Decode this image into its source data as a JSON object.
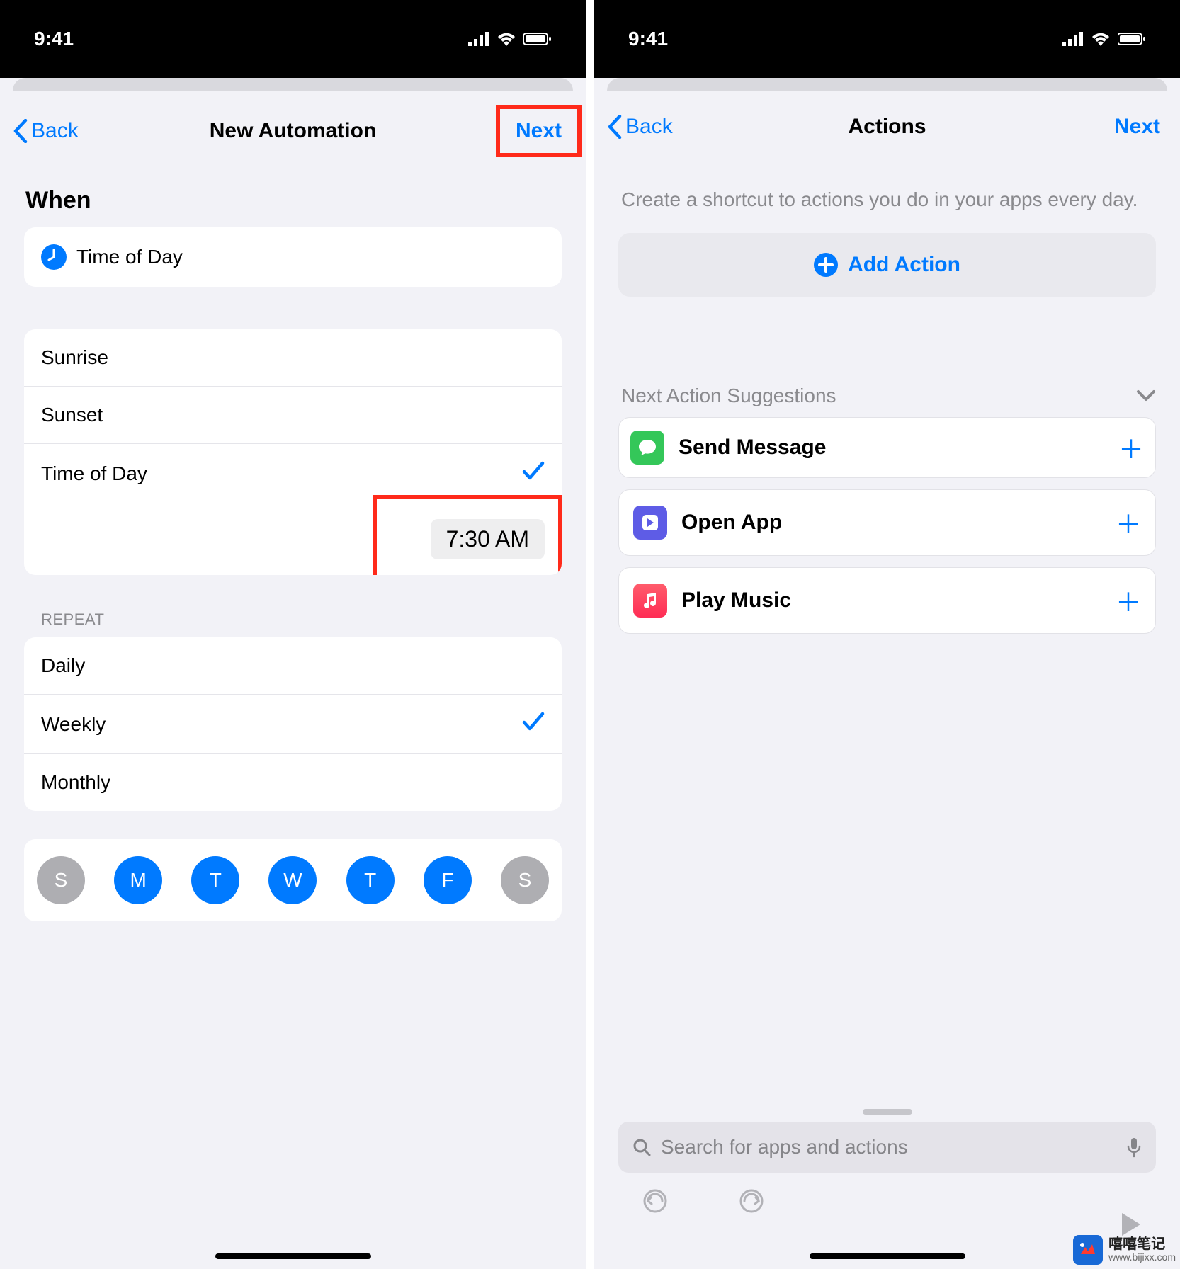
{
  "status": {
    "time": "9:41"
  },
  "left": {
    "nav": {
      "back": "Back",
      "title": "New Automation",
      "next": "Next"
    },
    "when_header": "When",
    "trigger_row": "Time of Day",
    "options": {
      "sunrise": "Sunrise",
      "sunset": "Sunset",
      "time_of_day": "Time of Day",
      "selected_time": "7:30 AM"
    },
    "repeat_label": "REPEAT",
    "repeat": {
      "daily": "Daily",
      "weekly": "Weekly",
      "monthly": "Monthly"
    },
    "days": [
      "S",
      "M",
      "T",
      "W",
      "T",
      "F",
      "S"
    ]
  },
  "right": {
    "nav": {
      "back": "Back",
      "title": "Actions",
      "next": "Next"
    },
    "subtext": "Create a shortcut to actions you do in your apps every day.",
    "add_action": "Add Action",
    "suggestions_header": "Next Action Suggestions",
    "suggestions": {
      "send_message": "Send Message",
      "open_app": "Open App",
      "play_music": "Play Music"
    },
    "search_placeholder": "Search for apps and actions"
  },
  "watermark": {
    "title": "嘻嘻笔记",
    "url": "www.bijixx.com"
  }
}
